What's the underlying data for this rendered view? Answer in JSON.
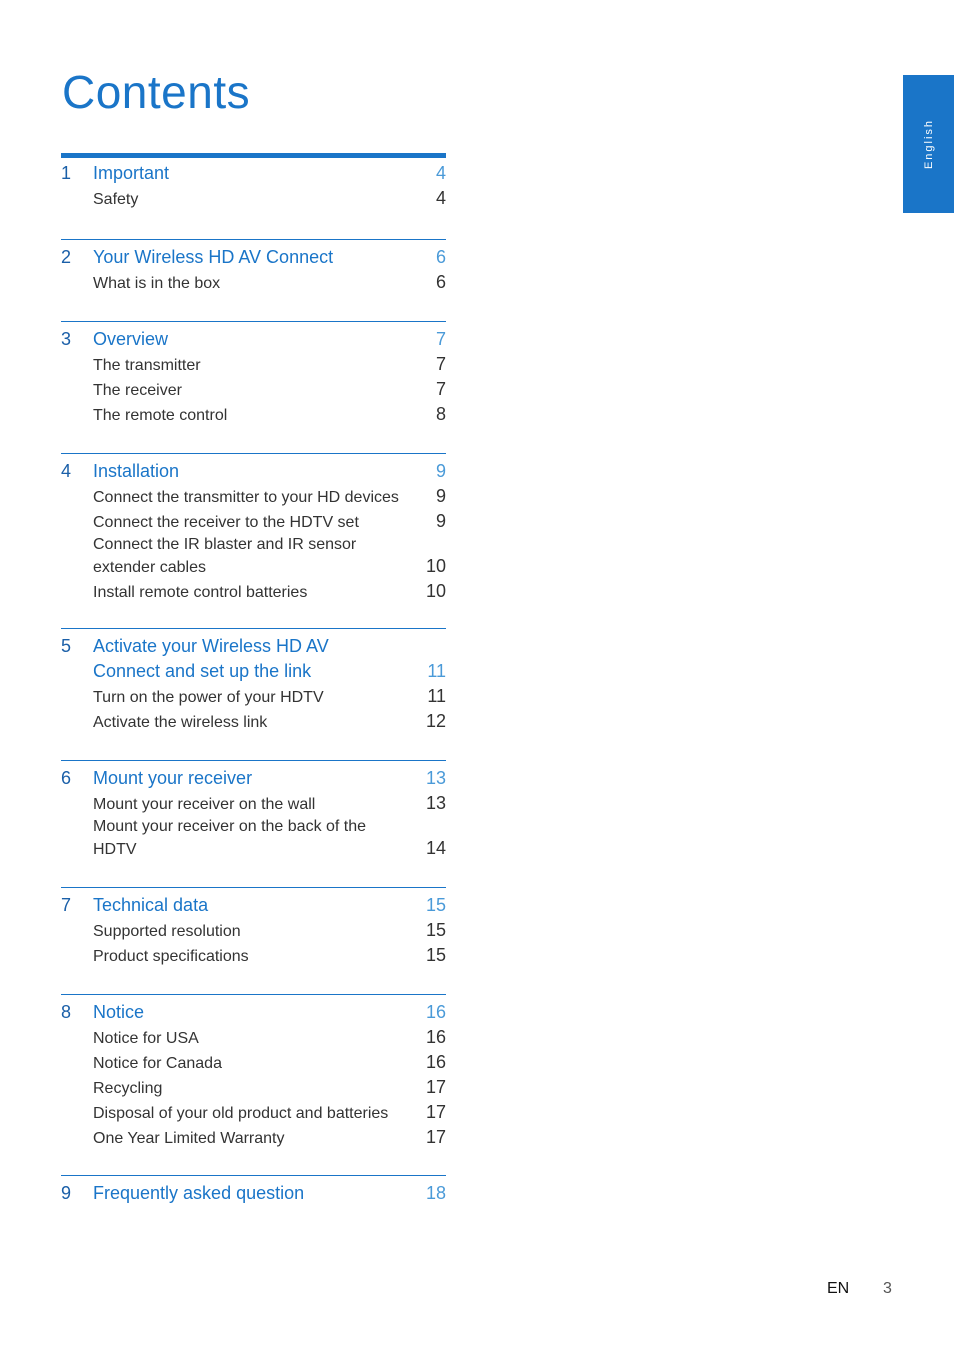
{
  "page": {
    "title": "Contents",
    "language_tab": "English",
    "footer_lang": "EN",
    "footer_page": "3",
    "accent_color": "#1a75c8"
  },
  "sections": [
    {
      "num": "1",
      "title_lines": [
        "Important"
      ],
      "page": "4",
      "items": [
        {
          "text_lines": [
            "Safety"
          ],
          "page": "4"
        }
      ]
    },
    {
      "num": "2",
      "title_lines": [
        "Your Wireless HD AV Connect"
      ],
      "page": "6",
      "items": [
        {
          "text_lines": [
            "What is in the box"
          ],
          "page": "6"
        }
      ]
    },
    {
      "num": "3",
      "title_lines": [
        "Overview"
      ],
      "page": "7",
      "items": [
        {
          "text_lines": [
            "The transmitter"
          ],
          "page": "7"
        },
        {
          "text_lines": [
            "The receiver"
          ],
          "page": "7"
        },
        {
          "text_lines": [
            "The remote control"
          ],
          "page": "8"
        }
      ]
    },
    {
      "num": "4",
      "title_lines": [
        "Installation"
      ],
      "page": "9",
      "items": [
        {
          "text_lines": [
            "Connect the transmitter to your HD devices"
          ],
          "page": "9"
        },
        {
          "text_lines": [
            "Connect the receiver to the HDTV set"
          ],
          "page": "9"
        },
        {
          "text_lines": [
            "Connect the IR blaster and IR sensor",
            "extender cables"
          ],
          "page": "10"
        },
        {
          "text_lines": [
            "Install remote control batteries"
          ],
          "page": "10"
        }
      ]
    },
    {
      "num": "5",
      "title_lines": [
        "Activate your Wireless HD AV",
        "Connect and set up the link"
      ],
      "page": "11",
      "items": [
        {
          "text_lines": [
            "Turn on the power of your HDTV"
          ],
          "page": "11"
        },
        {
          "text_lines": [
            "Activate the wireless link"
          ],
          "page": "12"
        }
      ]
    },
    {
      "num": "6",
      "title_lines": [
        "Mount your receiver"
      ],
      "page": "13",
      "items": [
        {
          "text_lines": [
            "Mount your receiver on the wall"
          ],
          "page": "13"
        },
        {
          "text_lines": [
            "Mount your receiver on the back of the",
            "HDTV"
          ],
          "page": "14"
        }
      ]
    },
    {
      "num": "7",
      "title_lines": [
        "Technical data"
      ],
      "page": "15",
      "items": [
        {
          "text_lines": [
            "Supported resolution"
          ],
          "page": "15"
        },
        {
          "text_lines": [
            "Product specifications"
          ],
          "page": "15"
        }
      ]
    },
    {
      "num": "8",
      "title_lines": [
        "Notice"
      ],
      "page": "16",
      "items": [
        {
          "text_lines": [
            "Notice for USA"
          ],
          "page": "16"
        },
        {
          "text_lines": [
            "Notice for Canada"
          ],
          "page": "16"
        },
        {
          "text_lines": [
            "Recycling"
          ],
          "page": "17"
        },
        {
          "text_lines": [
            "Disposal of your old product and batteries"
          ],
          "page": "17"
        },
        {
          "text_lines": [
            "One Year Limited Warranty"
          ],
          "page": "17"
        }
      ]
    },
    {
      "num": "9",
      "title_lines": [
        "Frequently asked question"
      ],
      "page": "18",
      "items": []
    }
  ]
}
